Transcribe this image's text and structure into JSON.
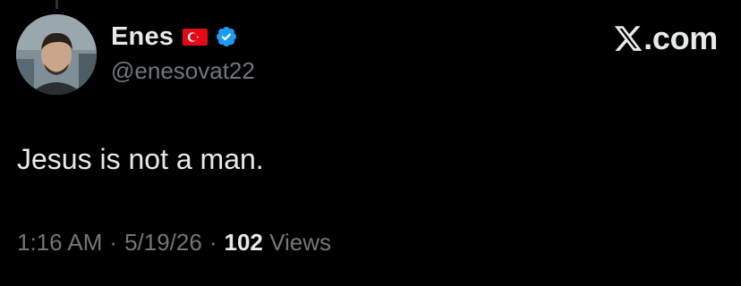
{
  "author": {
    "display_name": "Enes",
    "handle": "@enesovat22",
    "flag_icon": "turkey-flag-icon",
    "verified_icon": "verified-badge-icon",
    "verified_color": "#1d9bf0"
  },
  "brand": {
    "label": ".com",
    "logo_icon": "x-logo-icon"
  },
  "tweet": {
    "text": "Jesus is not a man.",
    "time": "1:16 AM",
    "date": "5/19/26",
    "separator": "·",
    "views_count": "102",
    "views_label": "Views"
  },
  "colors": {
    "background": "#000000",
    "primary_text": "#e7e9ea",
    "secondary_text": "#71767b",
    "flag_red": "#e30a17"
  }
}
